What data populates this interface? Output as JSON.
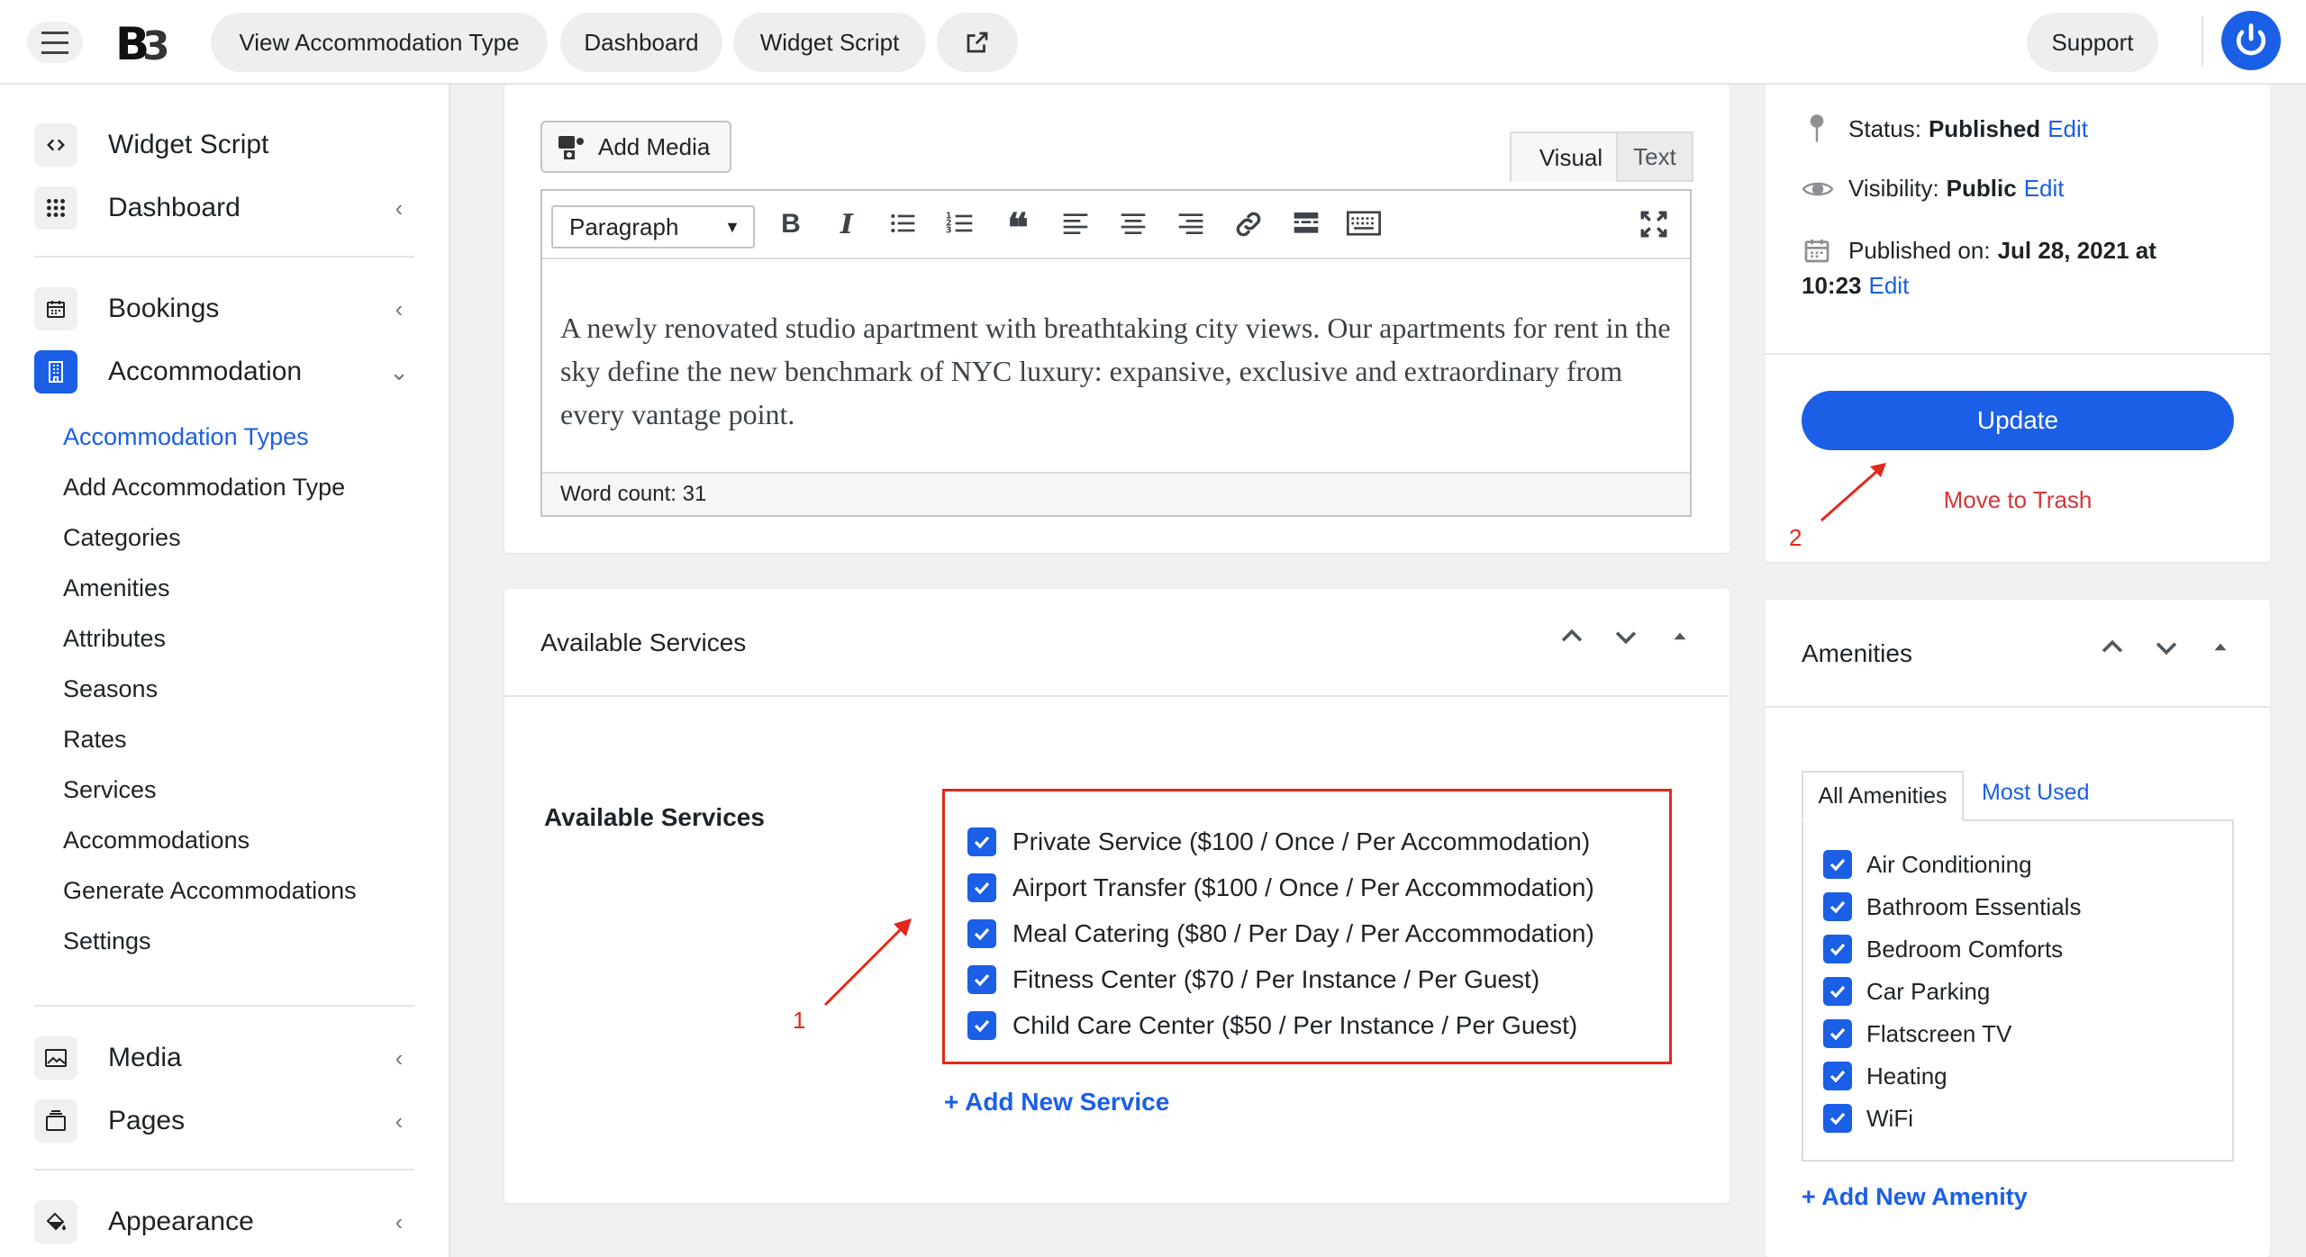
{
  "topbar": {
    "logo_text": "B3",
    "pills": [
      "View Accommodation Type",
      "Dashboard",
      "Widget Script"
    ],
    "external_link_icon": "external-link-icon",
    "support_label": "Support",
    "power_icon": "power-icon"
  },
  "sidebar": {
    "primary": [
      {
        "label": "Widget Script",
        "icon": "code-icon"
      },
      {
        "label": "Dashboard",
        "icon": "grid-icon"
      },
      {
        "label": "Bookings",
        "icon": "calendar-icon"
      },
      {
        "label": "Accommodation",
        "icon": "building-icon"
      }
    ],
    "submenu": [
      "Accommodation Types",
      "Add Accommodation Type",
      "Categories",
      "Amenities",
      "Attributes",
      "Seasons",
      "Rates",
      "Services",
      "Accommodations",
      "Generate Accommodations",
      "Settings"
    ],
    "secondary": [
      {
        "label": "Media",
        "icon": "media-icon"
      },
      {
        "label": "Pages",
        "icon": "pages-icon"
      },
      {
        "label": "Appearance",
        "icon": "paint-bucket-icon"
      }
    ]
  },
  "editor": {
    "add_media_label": "Add Media",
    "tabs": {
      "visual": "Visual",
      "text": "Text"
    },
    "format_select": "Paragraph",
    "content": "A newly renovated studio apartment with breathtaking city views. Our apartments for rent in the sky define the new benchmark of NYC luxury: expansive, exclusive and extraordinary from every vantage point.",
    "word_count": "Word count: 31"
  },
  "services_panel": {
    "title": "Available Services",
    "field_label": "Available Services",
    "items": [
      "Private Service ($100 / Once / Per Accommodation)",
      "Airport Transfer ($100 / Once / Per Accommodation)",
      "Meal Catering ($80 / Per Day / Per Accommodation)",
      "Fitness Center ($70 / Per Instance / Per Guest)",
      "Child Care Center ($50 / Per Instance / Per Guest)"
    ],
    "add_new": "+ Add New Service",
    "annotation": "1"
  },
  "publish_panel": {
    "status_label": "Status:",
    "status_value": "Published",
    "visibility_label": "Visibility:",
    "visibility_value": "Public",
    "published_label": "Published on:",
    "published_value_line1": "Jul 28, 2021 at",
    "published_value_line2": "10:23",
    "edit": "Edit",
    "update": "Update",
    "trash": "Move to Trash",
    "annotation": "2"
  },
  "amenities_panel": {
    "title": "Amenities",
    "tab_all": "All Amenities",
    "tab_most_used": "Most Used",
    "items": [
      "Air Conditioning",
      "Bathroom Essentials",
      "Bedroom Comforts",
      "Car Parking",
      "Flatscreen TV",
      "Heating",
      "WiFi"
    ],
    "add_new": "+ Add New Amenity"
  },
  "colors": {
    "accent": "#1a5fe6",
    "danger": "#d63638",
    "annotation": "#e2281b"
  }
}
